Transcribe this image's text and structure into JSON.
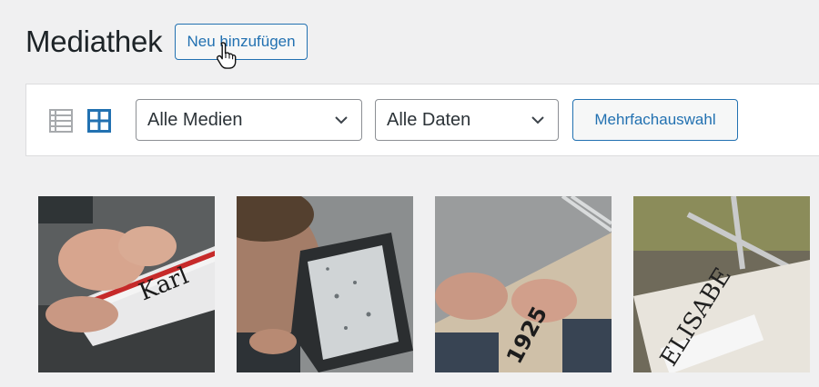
{
  "header": {
    "title": "Mediathek",
    "add_new_label": "Neu hinzufügen"
  },
  "toolbar": {
    "view_modes": [
      "list-view-icon",
      "grid-view-icon"
    ],
    "active_view": "grid",
    "media_filter": {
      "selected": "Alle Medien"
    },
    "date_filter": {
      "selected": "Alle Daten"
    },
    "bulk_select_label": "Mehrfachauswahl"
  },
  "media_items": [
    {
      "thumb_text": "Karl"
    },
    {
      "thumb_text": ""
    },
    {
      "thumb_text": "1925"
    },
    {
      "thumb_text": "ELISABE"
    }
  ],
  "colors": {
    "accent": "#2271b1",
    "background": "#f0f0f1",
    "text": "#1d2327"
  }
}
